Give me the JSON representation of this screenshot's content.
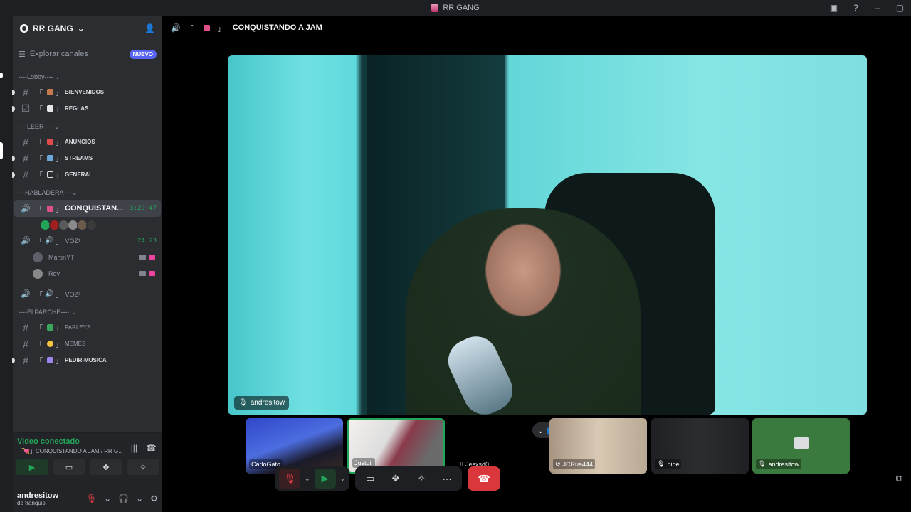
{
  "window": {
    "title": "RR GANG"
  },
  "server": {
    "name": "RR GANG",
    "explore_label": "Explorar canales",
    "new_badge": "NUEVO"
  },
  "categories": {
    "lobby": "----Lobby----",
    "leer": "----LEER----",
    "habladera": "---HABLADERA---",
    "parche": "----El PARCHE----"
  },
  "channels": {
    "bienvenidos": "BIENVENIDOS",
    "reglas": "REGLAS",
    "anuncios": "ANUNCIOS",
    "streams": "STREAMS",
    "general": "GENERAL",
    "parleys": "PARLEYS",
    "memes": "MEMES",
    "pedir_musica": "PEDIR-MUSICA"
  },
  "voice": {
    "active_name": "CONQUISTAN...",
    "active_time": "3:29:47",
    "voz1_name": "VOZ¹",
    "voz1_time": "24:23",
    "voz2_name": "VOZ²",
    "users": [
      "MartinYT",
      "Rey"
    ]
  },
  "voice_panel": {
    "status": "Video conectado",
    "channel": "「💘」CONQUISTANDO A JAM / RR G..."
  },
  "user": {
    "name": "andresitow",
    "status": "de tranquis"
  },
  "stage": {
    "title": "CONQUISTANDO A JAM",
    "main_name": "andresitow",
    "tiles": [
      "CarloGato",
      "Justdil",
      "Jesxsd0",
      "JCRua444",
      "pipe",
      "andresitow"
    ]
  },
  "colors": {
    "accent": "#5865f2",
    "green": "#23a559",
    "red": "#da373c"
  }
}
